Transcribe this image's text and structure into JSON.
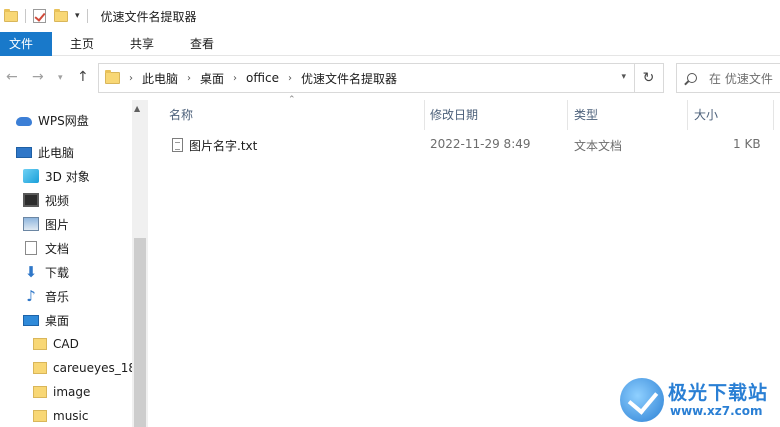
{
  "window": {
    "title": "优速文件名提取器"
  },
  "ribbon": {
    "tabs": [
      {
        "label": "文件"
      },
      {
        "label": "主页"
      },
      {
        "label": "共享"
      },
      {
        "label": "查看"
      }
    ]
  },
  "address": {
    "crumbs": [
      "此电脑",
      "桌面",
      "office",
      "优速文件名提取器"
    ]
  },
  "search": {
    "placeholder": "在 优速文件"
  },
  "nav": {
    "items": [
      {
        "label": "WPS网盘",
        "icon": "cloud-icon"
      },
      {
        "label": "此电脑",
        "icon": "computer-icon"
      },
      {
        "label": "3D 对象",
        "icon": "3d-objects-icon"
      },
      {
        "label": "视频",
        "icon": "video-icon"
      },
      {
        "label": "图片",
        "icon": "picture-icon"
      },
      {
        "label": "文档",
        "icon": "document-icon"
      },
      {
        "label": "下载",
        "icon": "download-icon"
      },
      {
        "label": "音乐",
        "icon": "music-icon"
      },
      {
        "label": "桌面",
        "icon": "desktop-icon"
      },
      {
        "label": "CAD",
        "icon": "folder-icon"
      },
      {
        "label": "careueyes_18",
        "icon": "folder-icon"
      },
      {
        "label": "image",
        "icon": "folder-icon"
      },
      {
        "label": "music",
        "icon": "folder-icon"
      }
    ]
  },
  "list": {
    "columns": {
      "name": "名称",
      "modified": "修改日期",
      "type": "类型",
      "size": "大小"
    },
    "rows": [
      {
        "name": "图片名字.txt",
        "modified": "2022-11-29 8:49",
        "type": "文本文档",
        "size": "1 KB"
      }
    ]
  },
  "watermark": {
    "title": "极光下载站",
    "url": "www.xz7.com"
  }
}
